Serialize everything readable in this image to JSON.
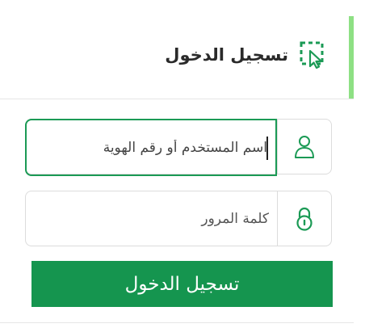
{
  "login": {
    "title": "تسجيل الدخول",
    "title_icon": "dashed-select-cursor-icon",
    "username": {
      "placeholder": "اسم المستخدم أو رقم الهوية",
      "value": "",
      "icon": "user-icon"
    },
    "password": {
      "placeholder": "كلمة المرور",
      "value": "",
      "icon": "lock-icon"
    },
    "submit_label": "تسجيل الدخول"
  },
  "colors": {
    "accent_green": "#15954f",
    "header_accent": "#8ee084",
    "focus_border": "#1b9a55"
  }
}
